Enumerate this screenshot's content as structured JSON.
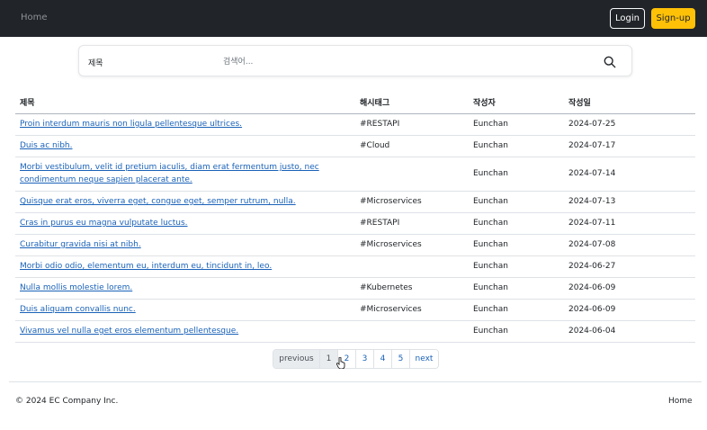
{
  "navbar": {
    "home_label": "Home",
    "login_label": "Login",
    "signup_label": "Sign-up",
    "colors": {
      "background": "#212529",
      "signup": "#ffc107"
    }
  },
  "search": {
    "field_select": "제목",
    "placeholder": "검색어...",
    "value": "",
    "icon": "search-icon"
  },
  "table": {
    "headers": [
      "제목",
      "해시태그",
      "작성자",
      "작성일"
    ],
    "rows": [
      {
        "title": "Proin interdum mauris non ligula pellentesque ultrices.",
        "hashtag": "#RESTAPI",
        "author": "Eunchan",
        "date": "2024-07-25"
      },
      {
        "title": "Duis ac nibh.",
        "hashtag": "#Cloud",
        "author": "Eunchan",
        "date": "2024-07-17"
      },
      {
        "title": "Morbi vestibulum, velit id pretium iaculis, diam erat fermentum justo, nec condimentum neque sapien placerat ante.",
        "hashtag": "",
        "author": "Eunchan",
        "date": "2024-07-14"
      },
      {
        "title": "Quisque erat eros, viverra eget, congue eget, semper rutrum, nulla.",
        "hashtag": "#Microservices",
        "author": "Eunchan",
        "date": "2024-07-13"
      },
      {
        "title": "Cras in purus eu magna vulputate luctus.",
        "hashtag": "#RESTAPI",
        "author": "Eunchan",
        "date": "2024-07-11"
      },
      {
        "title": "Curabitur gravida nisi at nibh.",
        "hashtag": "#Microservices",
        "author": "Eunchan",
        "date": "2024-07-08"
      },
      {
        "title": "Morbi odio odio, elementum eu, interdum eu, tincidunt in, leo.",
        "hashtag": "",
        "author": "Eunchan",
        "date": "2024-06-27"
      },
      {
        "title": "Nulla mollis molestie lorem.",
        "hashtag": "#Kubernetes",
        "author": "Eunchan",
        "date": "2024-06-09"
      },
      {
        "title": "Duis aliquam convallis nunc.",
        "hashtag": "#Microservices",
        "author": "Eunchan",
        "date": "2024-06-09"
      },
      {
        "title": "Vivamus vel nulla eget eros elementum pellentesque.",
        "hashtag": "",
        "author": "Eunchan",
        "date": "2024-06-04"
      }
    ]
  },
  "pagination": {
    "previous_label": "previous",
    "pages": [
      "1",
      "2",
      "3",
      "4",
      "5"
    ],
    "current_page": "1",
    "next_label": "next"
  },
  "footer": {
    "copyright": "© 2024 EC Company Inc.",
    "home_label": "Home"
  }
}
